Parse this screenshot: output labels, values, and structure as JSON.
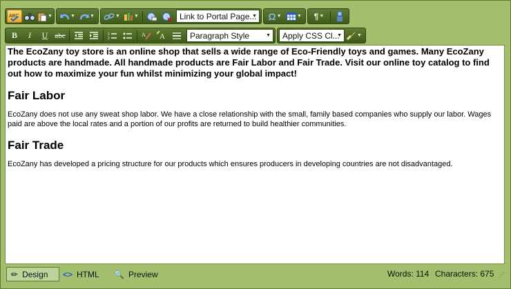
{
  "toolbar": {
    "link_dropdown": "Link to Portal Page...",
    "paragraph_style": "Paragraph Style",
    "css_class": "Apply CSS Cl...",
    "bold": "B",
    "italic": "I",
    "underline": "U",
    "strike": "abc"
  },
  "content": {
    "intro": "The EcoZany toy store is an online shop that sells a wide range of Eco-Friendly toys and games.  Many EcoZany products are handmade. All handmade products are Fair Labor and Fair Trade. Visit our online toy catalog to find out how to maximize your fun whilst minimizing your global impact!",
    "heading1": "Fair Labor",
    "para1": "EcoZany does not use any sweat shop labor. We have a close relationship with the small, family based companies who supply our labor. Wages paid are above the local rates and a portion of our profits are returned to build healthier communities.",
    "heading2": "Fair Trade",
    "para2": "EcoZany has developed a pricing structure for our products which ensures producers in developing countries are not disadvantaged."
  },
  "modes": {
    "design": "Design",
    "html": "HTML",
    "preview": "Preview"
  },
  "status": {
    "words": "Words: 114",
    "characters": "Characters: 675"
  }
}
